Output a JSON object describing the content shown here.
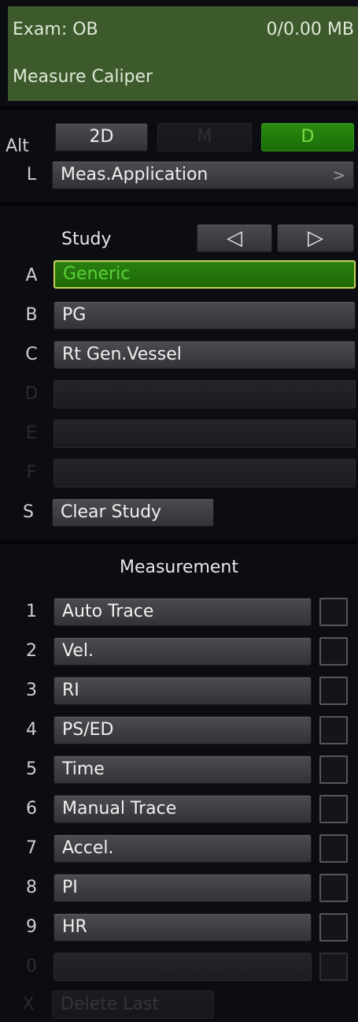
{
  "header": {
    "exam": "Exam: OB",
    "storage": "0/0.00 MB",
    "mode": "Measure Caliper"
  },
  "top": {
    "alt_label": "Alt",
    "l_label": "L",
    "modes": [
      "2D",
      "M",
      "D"
    ],
    "meas_app": "Meas.Application",
    "meas_app_arrow": ">"
  },
  "study": {
    "title": "Study",
    "prev": "◁",
    "next": "▷",
    "rows": [
      {
        "key": "A",
        "label": "Generic"
      },
      {
        "key": "B",
        "label": "PG"
      },
      {
        "key": "C",
        "label": "Rt Gen.Vessel"
      },
      {
        "key": "D",
        "label": ""
      },
      {
        "key": "E",
        "label": ""
      },
      {
        "key": "F",
        "label": ""
      }
    ],
    "clear_key": "S",
    "clear_label": "Clear Study"
  },
  "measurement": {
    "title": "Measurement",
    "rows": [
      {
        "key": "1",
        "label": "Auto Trace"
      },
      {
        "key": "2",
        "label": "Vel."
      },
      {
        "key": "3",
        "label": "RI"
      },
      {
        "key": "4",
        "label": "PS/ED"
      },
      {
        "key": "5",
        "label": "Time"
      },
      {
        "key": "6",
        "label": "Manual Trace"
      },
      {
        "key": "7",
        "label": "Accel."
      },
      {
        "key": "8",
        "label": "PI"
      },
      {
        "key": "9",
        "label": "HR"
      },
      {
        "key": "0",
        "label": ""
      }
    ],
    "delete_key": "X",
    "delete_label": "Delete Last"
  }
}
